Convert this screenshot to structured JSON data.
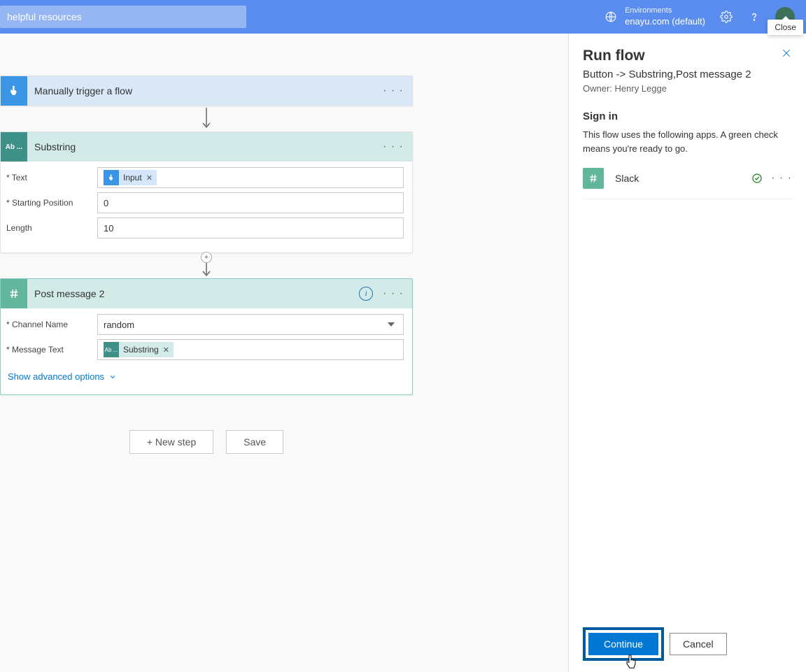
{
  "topbar": {
    "search_placeholder": "helpful resources",
    "environments_label": "Environments",
    "environment_name": "enayu.com (default)"
  },
  "tooltip": {
    "close": "Close"
  },
  "flow": {
    "trigger": {
      "title": "Manually trigger a flow"
    },
    "substring": {
      "title": "Substring",
      "icon_label": "Ab ...",
      "fields": {
        "text_label": "* Text",
        "text_token": "Input",
        "start_label": "* Starting Position",
        "start_value": "0",
        "length_label": "Length",
        "length_value": "10"
      }
    },
    "post": {
      "title": "Post message 2",
      "fields": {
        "channel_label": "* Channel Name",
        "channel_value": "random",
        "msg_label": "* Message Text",
        "msg_token": "Substring",
        "msg_token_icon": "Ab ..."
      },
      "advanced": "Show advanced options"
    },
    "buttons": {
      "new_step": "+ New step",
      "save": "Save"
    }
  },
  "panel": {
    "title": "Run flow",
    "subtitle": "Button -> Substring,Post message 2",
    "owner": "Owner: Henry Legge",
    "signin": "Sign in",
    "desc": "This flow uses the following apps. A green check means you're ready to go.",
    "app_name": "Slack",
    "continue": "Continue",
    "cancel": "Cancel"
  }
}
